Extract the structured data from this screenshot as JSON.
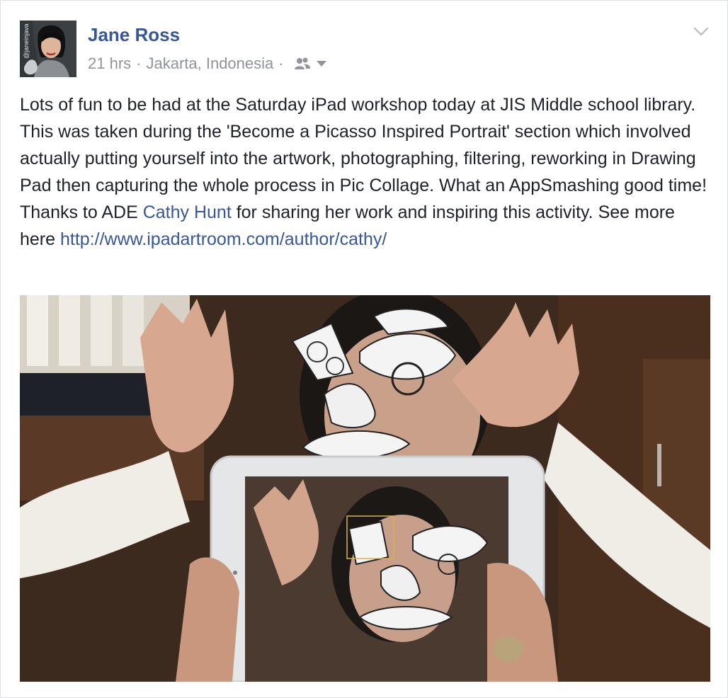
{
  "post": {
    "author": "Jane Ross",
    "time": "21 hrs",
    "separator": "·",
    "location": "Jakarta, Indonesia",
    "audience_icon": "friends-icon",
    "menu_icon": "chevron-down-icon",
    "avatar_watermark": "@janeinjava",
    "body": {
      "part1": "Lots of fun to be had at the Saturday iPad workshop today at JIS Middle school library. This was taken during the 'Become a Picasso Inspired Portrait' section which involved actually putting yourself into the artwork, photographing, filtering, reworking in Drawing Pad then capturing the whole process in Pic Collage. What an AppSmashing good time! Thanks to ADE ",
      "mention": "Cathy Hunt",
      "part2": " for sharing her work and inspiring this activity. See more here ",
      "link": "http://www.ipadartroom.com/author/cathy/"
    }
  },
  "colors": {
    "link": "#365899",
    "meta": "#90949c",
    "text": "#1d2129"
  }
}
